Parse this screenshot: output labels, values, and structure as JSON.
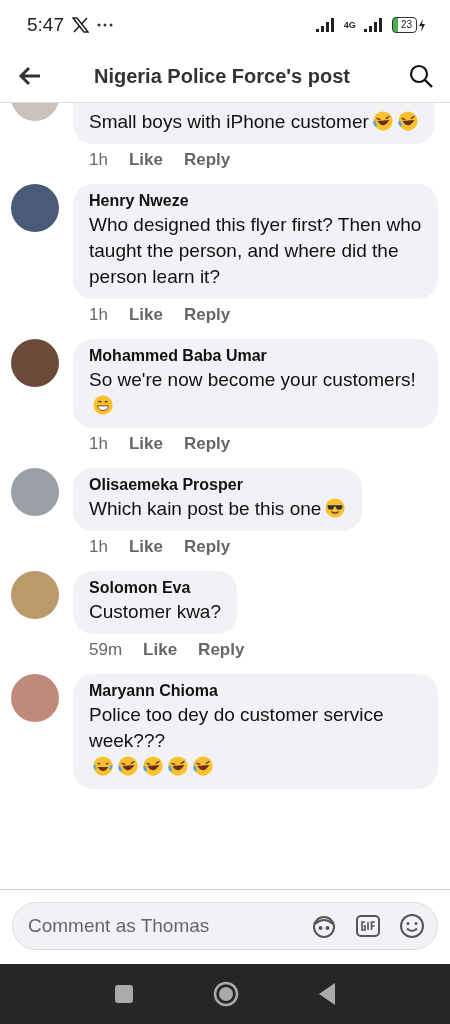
{
  "status_bar": {
    "time": "5:47",
    "network_type": "4G",
    "battery": "23"
  },
  "header": {
    "title": "Nigeria Police Force's post"
  },
  "comments": [
    {
      "text": "Small boys with iPhone customer",
      "emojis": [
        {
          "kind": "rofl"
        },
        {
          "kind": "rofl"
        }
      ],
      "time": "1h",
      "like": "Like",
      "reply": "Reply"
    },
    {
      "name": "Henry Nweze",
      "text": "Who designed this flyer first? Then who taught the person, and where did the person learn it?",
      "time": "1h",
      "like": "Like",
      "reply": "Reply"
    },
    {
      "name": "Mohammed Baba Umar",
      "text": "So we're now become your customers!",
      "emojis": [
        {
          "kind": "grin"
        }
      ],
      "time": "1h",
      "like": "Like",
      "reply": "Reply"
    },
    {
      "name": "Olisaemeka Prosper",
      "text": "Which kain post be this one",
      "emojis": [
        {
          "kind": "cool"
        }
      ],
      "time": "1h",
      "like": "Like",
      "reply": "Reply"
    },
    {
      "name": "Solomon Eva",
      "text": "Customer kwa?",
      "time": "59m",
      "like": "Like",
      "reply": "Reply"
    },
    {
      "name": "Maryann Chioma",
      "text": "Police too dey do customer service week???",
      "emojis": [
        {
          "kind": "laugh"
        },
        {
          "kind": "rofl"
        },
        {
          "kind": "rofl"
        },
        {
          "kind": "rofl"
        },
        {
          "kind": "rofl"
        }
      ]
    }
  ],
  "composer": {
    "placeholder": "Comment as Thomas"
  }
}
